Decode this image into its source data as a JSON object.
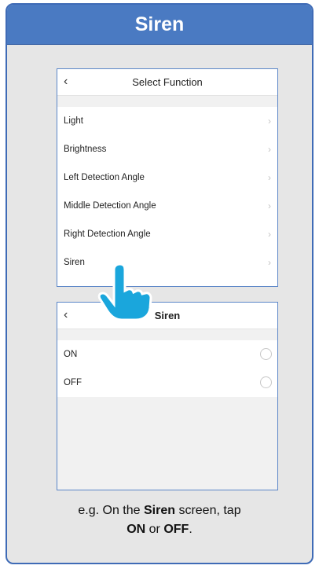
{
  "header": {
    "title": "Siren"
  },
  "screen1": {
    "title": "Select Function",
    "items": [
      {
        "label": "Light"
      },
      {
        "label": "Brightness"
      },
      {
        "label": "Left Detection Angle"
      },
      {
        "label": "Middle Detection Angle"
      },
      {
        "label": "Right Detection Angle"
      },
      {
        "label": "Siren"
      }
    ]
  },
  "screen2": {
    "title": "Siren",
    "options": [
      {
        "label": "ON"
      },
      {
        "label": "OFF"
      }
    ]
  },
  "icons": {
    "back": "chevron-left-icon",
    "chevron": "chevron-right-icon",
    "hand": "pointing-hand-icon",
    "hand_color": "#1aa6dc"
  },
  "caption": {
    "part1": "e.g. On the ",
    "bold1": "Siren",
    "part2": " screen, tap",
    "bold2": "ON",
    "part3": " or ",
    "bold3": "OFF",
    "part4": "."
  }
}
